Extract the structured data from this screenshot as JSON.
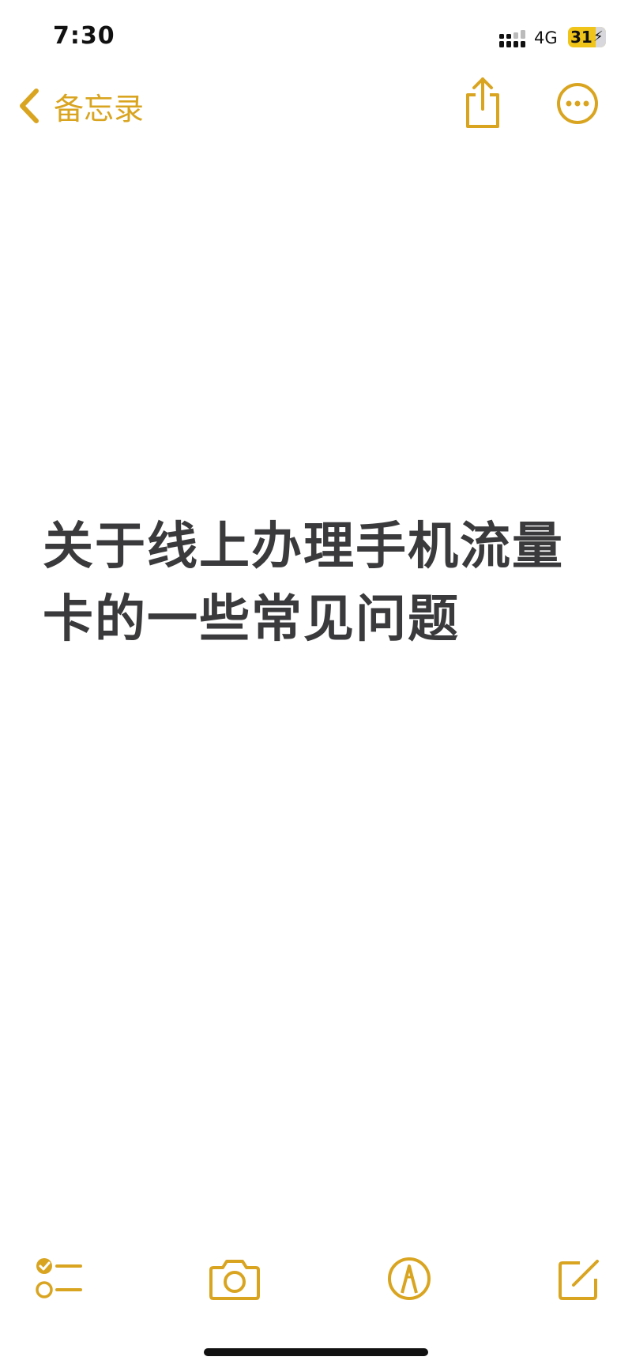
{
  "status_bar": {
    "time": "7:30",
    "network": "4G",
    "battery": "31",
    "battery_charging_icon": "bolt-icon",
    "signal_icon": "cellular-signal-icon"
  },
  "nav": {
    "back_label": "备忘录",
    "back_icon": "chevron-left-icon",
    "share_icon": "share-icon",
    "more_icon": "ellipsis-circle-icon"
  },
  "note": {
    "title": "关于线上办理手机流量卡的一些常见问题"
  },
  "toolbar": {
    "checklist_icon": "checklist-icon",
    "camera_icon": "camera-icon",
    "markup_icon": "markup-pen-icon",
    "compose_icon": "compose-icon"
  },
  "colors": {
    "accent": "#d9a521",
    "text": "#3a3a3c",
    "background": "#ffffff"
  }
}
